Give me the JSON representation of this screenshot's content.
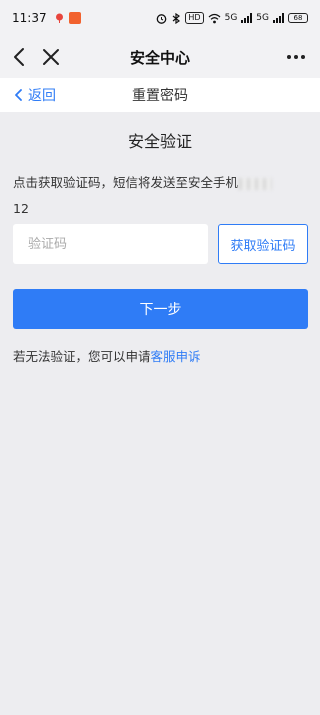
{
  "status_bar": {
    "time": "11:37",
    "network_label": "HD",
    "signal_1": "5G",
    "signal_2": "5G",
    "battery": "68"
  },
  "nav": {
    "title": "安全中心",
    "icons": [
      "back-arrow-icon",
      "close-icon",
      "more-icon"
    ]
  },
  "sub_header": {
    "back_label": "返回",
    "title": "重置密码"
  },
  "content": {
    "section_title": "安全验证",
    "info_text": "点击获取验证码，短信将发送至安全手机",
    "info_text_tail": "12",
    "code_input_placeholder": "验证码",
    "get_code_label": "获取验证码",
    "next_label": "下一步",
    "help_text": "若无法验证，您可以申请",
    "appeal_link": "客服申诉"
  },
  "colors": {
    "accent": "#2f7cf6",
    "background": "#ededf0",
    "header_bg": "#f2f2f4",
    "card_bg": "#ffffff"
  }
}
